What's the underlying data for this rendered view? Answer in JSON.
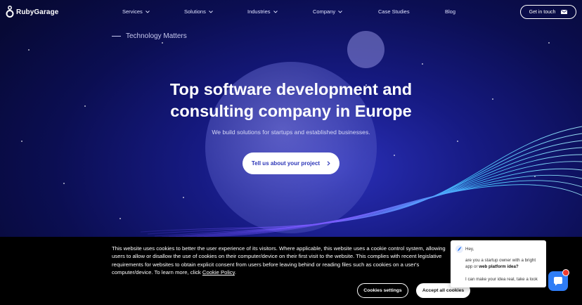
{
  "brand": {
    "name": "RubyGarage",
    "color": "#ffffff"
  },
  "nav": {
    "items": [
      {
        "label": "Services",
        "dropdown": true
      },
      {
        "label": "Solutions",
        "dropdown": true
      },
      {
        "label": "Industries",
        "dropdown": true
      },
      {
        "label": "Company",
        "dropdown": true
      },
      {
        "label": "Case Studies",
        "dropdown": false
      },
      {
        "label": "Blog",
        "dropdown": false
      }
    ],
    "cta_label": "Get in touch",
    "cta_icon": "mail-icon"
  },
  "hero": {
    "eyebrow": "Technology Matters",
    "title_line1": "Top software development and",
    "title_line2": "consulting company in Europe",
    "subtitle": "We build solutions for startups and established businesses.",
    "cta_label": "Tell us about your project",
    "cta_icon": "chevron-right-icon",
    "cta_text_color": "#2c36b8"
  },
  "cookie": {
    "text": "This website uses cookies to better the user experience of its visitors. Where applicable, this website uses a cookie control system, allowing users to allow or disallow the use of cookies on their computer/device on their first visit to the website. This complies with recent legislative requirements for websites to obtain explicit consent from users before leaving behind or reading files such as cookies on a user's computer/device. To learn more, click",
    "link_label": "Cookie Policy",
    "link_suffix": ".",
    "settings_label": "Cookies settings",
    "accept_label": "Accept all cookies"
  },
  "chat": {
    "greeting": "Hey,",
    "line2_prefix": "are you a startup owner with a bright app or",
    "line2_bold": "web platform idea?",
    "line3": "I can make your idea real, take a look",
    "launcher_icon": "chat-bubble-icon",
    "launcher_color": "#2f7df6",
    "badge_color": "#f03a2e"
  },
  "colors": {
    "background": "#0b0e52",
    "accent_blue": "#2f7df6"
  }
}
